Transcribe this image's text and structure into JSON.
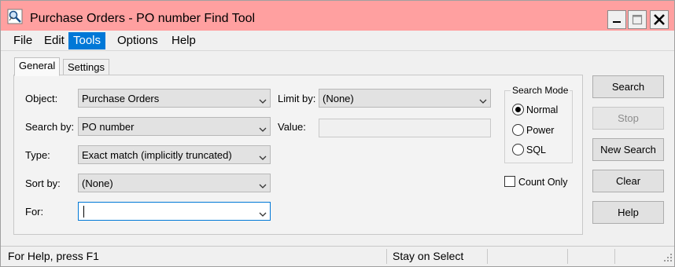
{
  "window": {
    "title": "Purchase Orders - PO number Find Tool",
    "title_bar_color": "#ffa0a0"
  },
  "caption_buttons": {
    "minimize_icon": "minimize-icon",
    "maximize_icon": "maximize-icon",
    "close_icon": "close-icon"
  },
  "menu": {
    "items": [
      {
        "label": "File"
      },
      {
        "label": "Edit"
      },
      {
        "label": "Tools",
        "active": true
      },
      {
        "label": "Options"
      },
      {
        "label": "Help"
      }
    ],
    "active_color": "#0078d7"
  },
  "tabs": [
    {
      "label": "General",
      "selected": true
    },
    {
      "label": "Settings",
      "selected": false
    }
  ],
  "form": {
    "object_label": "Object:",
    "object_value": "Purchase Orders",
    "search_by_label": "Search by:",
    "search_by_value": "PO number",
    "type_label": "Type:",
    "type_value": "Exact match (implicitly truncated)",
    "sort_by_label": "Sort by:",
    "sort_by_value": "(None)",
    "for_label": "For:",
    "for_value": "",
    "limit_by_label": "Limit by:",
    "limit_by_value": "(None)",
    "value_label": "Value:",
    "value_value": ""
  },
  "search_mode": {
    "legend": "Search Mode",
    "options": [
      {
        "label": "Normal",
        "selected": true
      },
      {
        "label": "Power",
        "selected": false
      },
      {
        "label": "SQL",
        "selected": false
      }
    ]
  },
  "count_only": {
    "label": "Count Only",
    "checked": false
  },
  "buttons": {
    "search": "Search",
    "stop": "Stop",
    "new_search": "New Search",
    "clear": "Clear",
    "help": "Help"
  },
  "status": {
    "help_text": "For Help, press F1",
    "mode_text": "Stay on Select"
  }
}
